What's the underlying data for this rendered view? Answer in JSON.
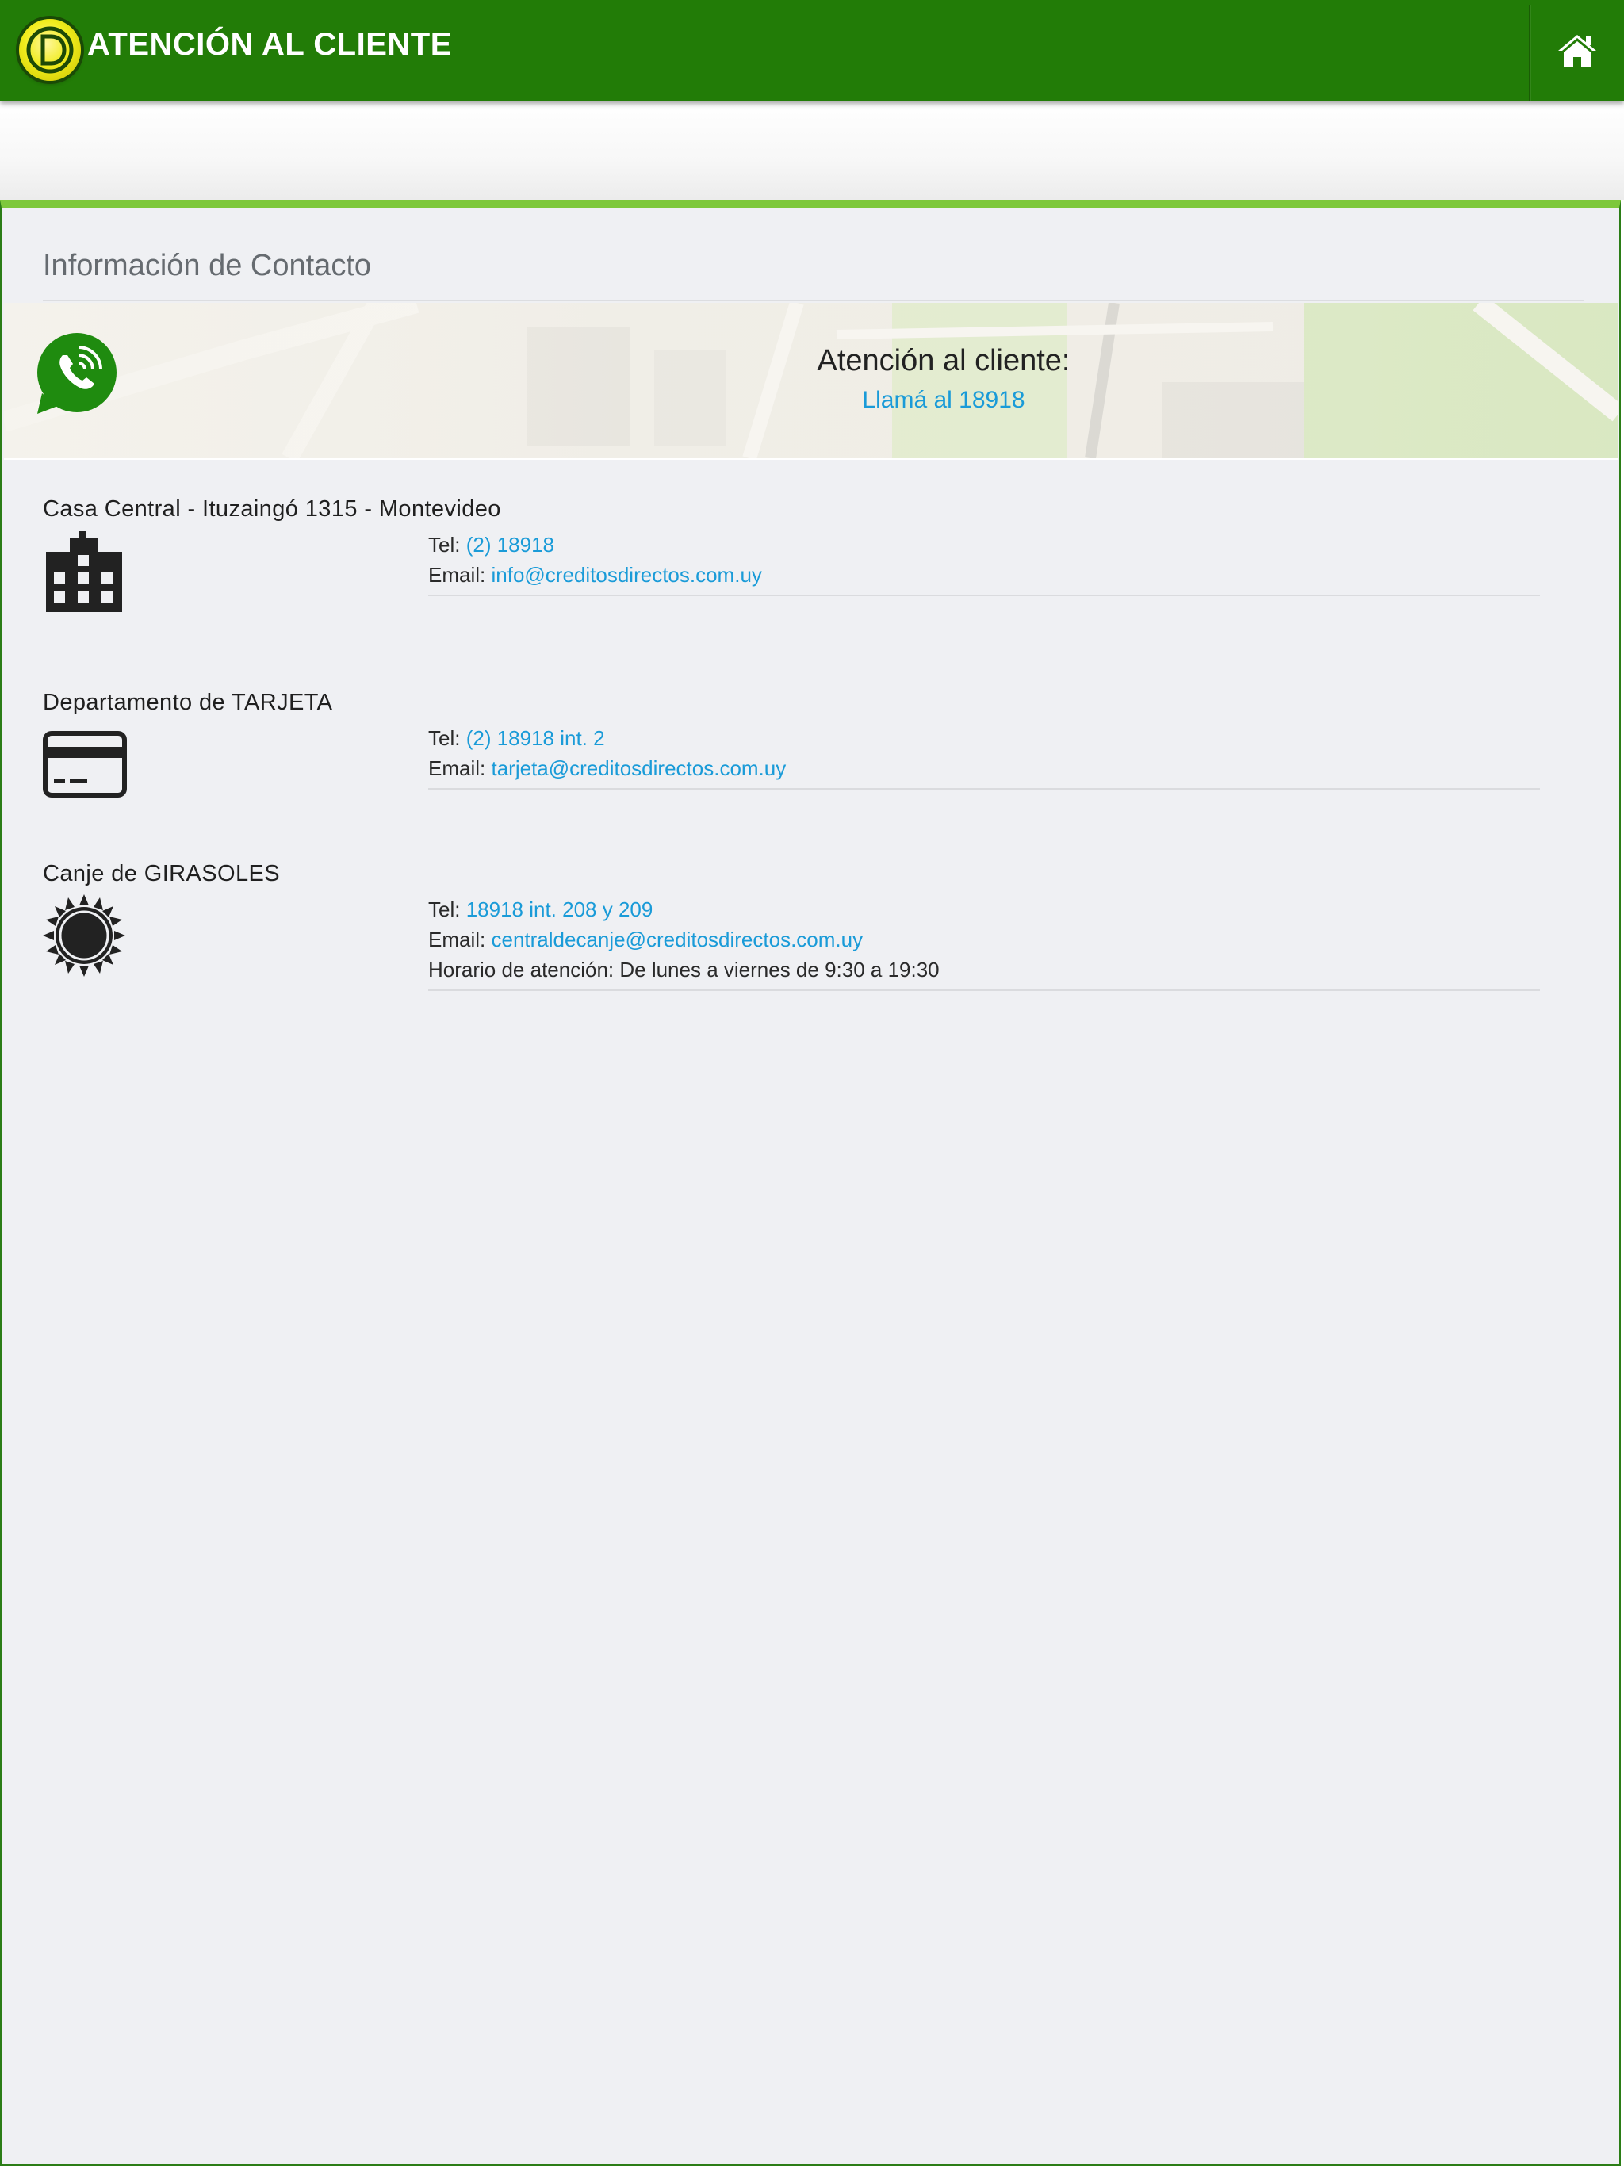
{
  "header": {
    "title": "ATENCIÓN AL CLIENTE",
    "logo_letters": "CD",
    "home_icon": "home-icon",
    "background_color": "#227c07"
  },
  "main": {
    "section_title": "Información de Contacto",
    "accent_color": "#7dc83b"
  },
  "banner": {
    "icon": "whatsapp-phone-icon",
    "heading": "Atención al cliente:",
    "link": "Llamá al 18918"
  },
  "contacts": [
    {
      "title": "Casa Central - Ituzaingó 1315 - Montevideo",
      "icon": "building-icon",
      "tel_label": "Tel:",
      "tel_value": "(2) 18918",
      "email_label": "Email:",
      "email_value": "info@creditosdirectos.com.uy"
    },
    {
      "title": "Departamento de TARJETA",
      "icon": "credit-card-icon",
      "tel_label": "Tel:",
      "tel_value": "(2) 18918 int. 2",
      "email_label": "Email:",
      "email_value": "tarjeta@creditosdirectos.com.uy"
    },
    {
      "title": "Canje de GIRASOLES",
      "icon": "sunflower-icon",
      "tel_label": "Tel:",
      "tel_value": "18918 int. 208 y 209",
      "email_label": "Email:",
      "email_value": "centraldecanje@creditosdirectos.com.uy",
      "hours": "Horario de atención: De lunes a viernes de 9:30 a 19:30"
    }
  ],
  "colors": {
    "link": "#1a9bd8",
    "panel_background": "#eff0f3"
  }
}
